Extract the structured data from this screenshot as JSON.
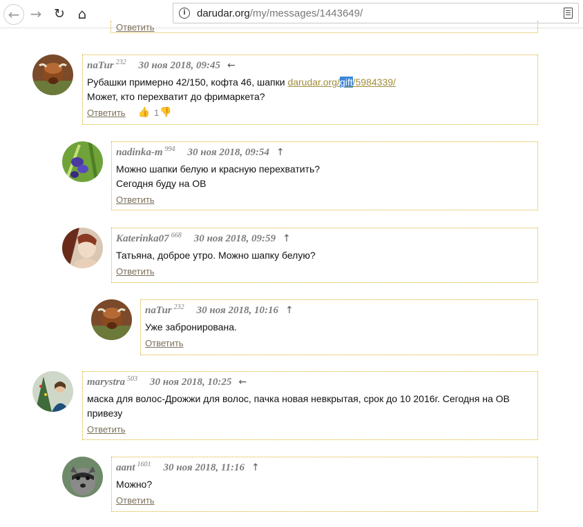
{
  "browser": {
    "url_domain": "darudar.org",
    "url_path": "/my/messages/1443649/",
    "back_icon": "←",
    "forward_icon": "→",
    "reload_icon": "↻",
    "home_icon": "⌂",
    "info_icon": "i"
  },
  "reply_label": "Ответить",
  "comments": [
    {
      "author": "naTur",
      "score": "232",
      "date": "30 ноя 2018, 09:45",
      "arrow": "←",
      "line1_prefix": "Рубашки примерно 42/150, кофта 46, шапки ",
      "link_a": "darudar.org/",
      "link_b": "gift",
      "link_c": "/5984339/",
      "line2": "Может, кто перехватит до фримаркета?",
      "likes": "1",
      "avatar": "highland-cow"
    },
    {
      "author": "nadinka-m",
      "score": "994",
      "date": "30 ноя 2018, 09:54",
      "arrow": "↑",
      "line1": "Можно шапки белую и красную перехватить?",
      "line2": "Сегодня буду на ОВ",
      "avatar": "iris-flowers"
    },
    {
      "author": "Katerinka07",
      "score": "668",
      "date": "30 ноя 2018, 09:59",
      "arrow": "↑",
      "line1": "Татьяна, доброе утро. Можно шапку белую?",
      "avatar": "painted-woman"
    },
    {
      "author": "naTur",
      "score": "232",
      "date": "30 ноя 2018, 10:16",
      "arrow": "↑",
      "line1": "Уже забронирована.",
      "avatar": "highland-cow"
    },
    {
      "author": "marystra",
      "score": "503",
      "date": "30 ноя 2018, 10:25",
      "arrow": "←",
      "line1": "маска для волос-Дрожжи для волос, пачка новая невкрытая, срок до 10 2016г. Сегодня на ОВ",
      "line2": "привезу",
      "avatar": "christmas-photo"
    },
    {
      "author": "aant",
      "score": "1601",
      "date": "30 ноя 2018, 11:16",
      "arrow": "↑",
      "line1": "Можно?",
      "avatar": "raccoon"
    }
  ]
}
